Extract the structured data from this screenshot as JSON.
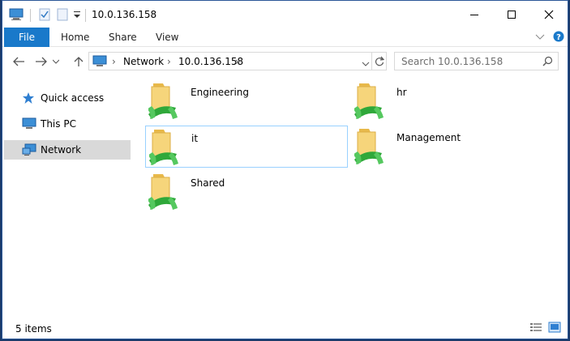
{
  "window": {
    "title": "10.0.136.158"
  },
  "ribbon": {
    "tabs": [
      {
        "label": "File"
      },
      {
        "label": "Home"
      },
      {
        "label": "Share"
      },
      {
        "label": "View"
      }
    ]
  },
  "address": {
    "crumbs": [
      {
        "label": "Network"
      },
      {
        "label": "10.0.136.158"
      }
    ]
  },
  "search": {
    "placeholder": "Search 10.0.136.158"
  },
  "nav": {
    "items": [
      {
        "label": "Quick access"
      },
      {
        "label": "This PC"
      },
      {
        "label": "Network"
      }
    ]
  },
  "folders": [
    {
      "name": "Engineering"
    },
    {
      "name": "hr"
    },
    {
      "name": "it"
    },
    {
      "name": "Management"
    },
    {
      "name": "Shared"
    }
  ],
  "status": {
    "item_count": "5 items"
  },
  "colors": {
    "accent": "#1979ca",
    "selection": "#d9d9d9",
    "focus_border": "#99d1ff",
    "window_border": "#2b5797"
  }
}
